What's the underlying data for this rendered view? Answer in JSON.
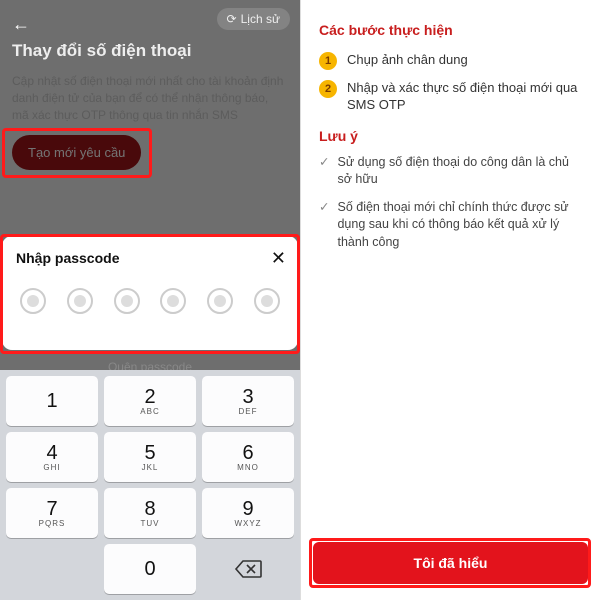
{
  "left": {
    "back": "←",
    "history": "Lịch sử",
    "title": "Thay đổi số điện thoại",
    "desc": "Cập nhật số điện thoại mới nhất cho tài khoản định danh điện tử của bạn để có thể nhận thông báo, mã xác thực OTP thông qua tin nhắn SMS",
    "request_btn": "Tạo mới yêu cầu",
    "modal_title": "Nhập passcode",
    "forgot": "Quên passcode",
    "keys": {
      "k1": "1",
      "k2": "2",
      "k3": "3",
      "k4": "4",
      "k5": "5",
      "k6": "6",
      "k7": "7",
      "k8": "8",
      "k9": "9",
      "k0": "0",
      "s2": "ABC",
      "s3": "DEF",
      "s4": "GHI",
      "s5": "JKL",
      "s6": "MNO",
      "s7": "PQRS",
      "s8": "TUV",
      "s9": "WXYZ"
    }
  },
  "right": {
    "steps_title": "Các bước thực hiện",
    "step1_num": "1",
    "step1": "Chụp ảnh chân dung",
    "step2_num": "2",
    "step2": "Nhập và xác thực số điện thoại mới qua SMS OTP",
    "note_title": "Lưu ý",
    "note1": "Sử dụng số điện thoại do công dân là chủ sở hữu",
    "note2": "Số điện thoại mới chỉ chính thức được sử dụng sau khi có thông báo kết quả xử lý thành công",
    "cta": "Tôi đã hiểu"
  }
}
